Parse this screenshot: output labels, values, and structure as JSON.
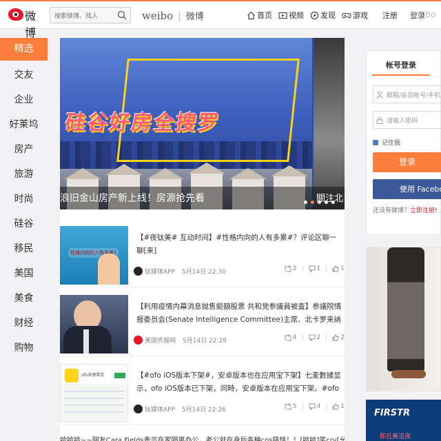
{
  "header": {
    "logo_text": "微博",
    "search_placeholder": "搜索微博、找人",
    "brand_en": "weibo",
    "brand_sep": "|",
    "brand_cn": "微博",
    "nav": [
      {
        "label": "首页",
        "icon": "home-icon"
      },
      {
        "label": "视频",
        "icon": "video-icon"
      },
      {
        "label": "发现",
        "icon": "discover-icon"
      },
      {
        "label": "游戏",
        "icon": "game-icon"
      }
    ],
    "register": "注册",
    "login": "登录",
    "brand_small": "weibo"
  },
  "sidebar": {
    "items": [
      "精选",
      "交友",
      "企业",
      "好莱坞",
      "房产",
      "旅游",
      "时尚",
      "硅谷",
      "移民",
      "美国",
      "美食",
      "财经",
      "购物"
    ]
  },
  "banner": {
    "title": "硅谷好房全搜罗",
    "caption": "浪旧金山房产新上线！房源抢先看",
    "caption_side": "關注北美",
    "slide_count": 5,
    "active_slide": 1
  },
  "feed": [
    {
      "title": "【#夜钛美# 互动时间】#性格内向的人有多累#？评论区聊一聊[来]",
      "source": "钛媒体APP",
      "time": "5月14日 22:30",
      "reposts": "2",
      "comments": "1",
      "likes": "1",
      "thumb_text": "性格内向的人有多累?"
    },
    {
      "title": "【利用疫情内幕消息抛售鉅額股票 共和党参議員被査】参議院情报委员会(Senate Intelligence Committee)主席、北卡罗来纳州参議員理査德·伯尔...",
      "source": "美国侨报网",
      "time": "5月14日 22:28",
      "reposts": "4",
      "comments": "2",
      "likes": "2"
    },
    {
      "title": "【#ofo iOS版本下架#，安卓版本也在应用宝下架】七麦數據显示，ofo iOS版本已下架，同時，安卓版本在应用宝下架。#ofo下架#",
      "source": "钛媒体APP",
      "time": "5月14日 22:26",
      "reposts": "5",
      "comments": "4",
      "likes": "1",
      "thumb_text": "ofo共享单车"
    }
  ],
  "bottom_text": "哈哈哈~~网友Cara Fields表示在家隔离办公，老公就在身后各种cos搞怪！！[哈哈]笑cry[允悲]",
  "login_panel": {
    "tab": "帐号登录",
    "username_placeholder": "邮箱/会员帐号/手机号",
    "password_placeholder": "请输入密码",
    "remember": "记住我",
    "login_button": "登录",
    "facebook_button": "使用 Facebook",
    "register_prompt": "还没有微博？",
    "register_link": "立即注册!"
  },
  "ad2": {
    "title": "FIRSTR",
    "subtitle": "即丘美洁夜"
  },
  "colors": {
    "accent": "#fa7d3c",
    "weibo_red": "#e6162d",
    "facebook": "#3b5998"
  }
}
